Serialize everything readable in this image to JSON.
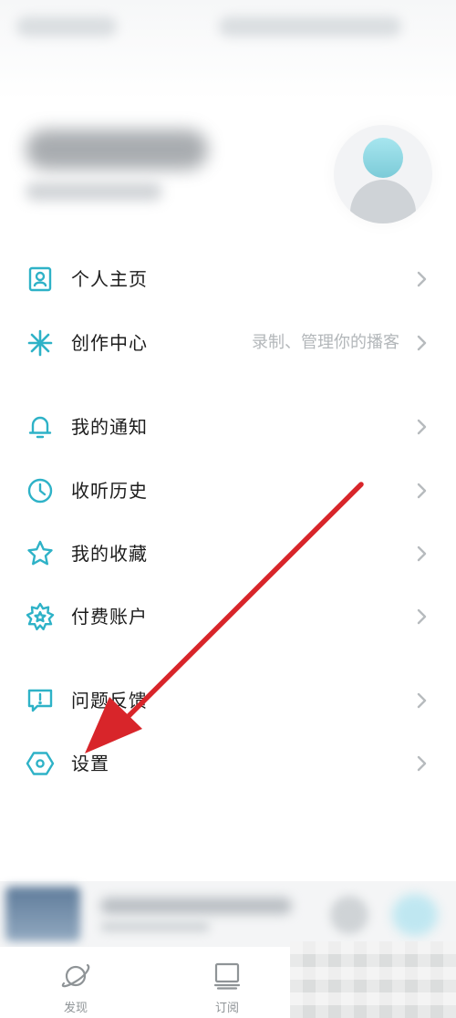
{
  "colors": {
    "accent": "#2eb2c7",
    "annotation": "#d8252a",
    "chevron": "#b7bbbe"
  },
  "menu": [
    {
      "label": "个人主页",
      "icon": "person-card-icon",
      "hint": ""
    },
    {
      "label": "创作中心",
      "icon": "asterisk-star-icon",
      "hint": "录制、管理你的播客"
    },
    {
      "label": "我的通知",
      "icon": "bell-icon",
      "hint": ""
    },
    {
      "label": "收听历史",
      "icon": "clock-icon",
      "hint": ""
    },
    {
      "label": "我的收藏",
      "icon": "star-icon",
      "hint": ""
    },
    {
      "label": "付费账户",
      "icon": "badge-star-icon",
      "hint": ""
    },
    {
      "label": "问题反馈",
      "icon": "feedback-icon",
      "hint": ""
    },
    {
      "label": "设置",
      "icon": "hexagon-gear-icon",
      "hint": ""
    }
  ],
  "bottom_nav": [
    {
      "label": "发现",
      "icon": "planet-icon"
    },
    {
      "label": "订阅",
      "icon": "monitor-icon"
    }
  ]
}
